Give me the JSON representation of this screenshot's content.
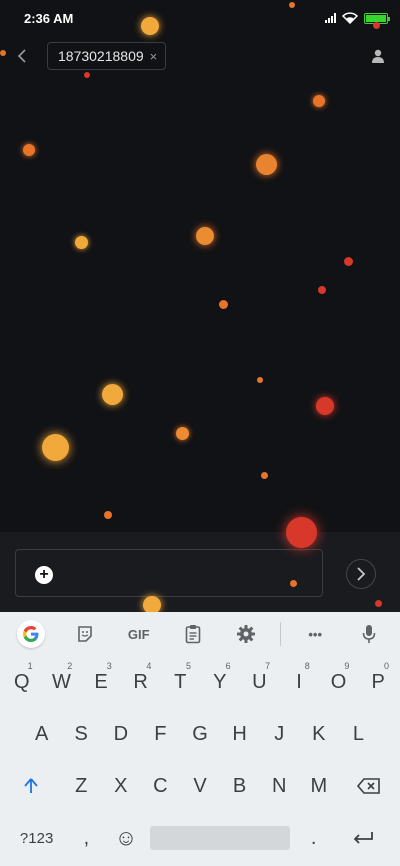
{
  "status": {
    "time": "2:36 AM"
  },
  "header": {
    "recipient": "18730218809",
    "remove_glyph": "×"
  },
  "icons": {
    "back": "chevron-left-icon",
    "person": "person-icon",
    "plus": "plus-icon",
    "send": "chevron-right-icon",
    "signal": "signal-icon",
    "wifi": "wifi-icon",
    "battery": "battery-icon"
  },
  "composer": {
    "plus_label": "+"
  },
  "keyboard": {
    "gif_label": "GIF",
    "more_label": "•••",
    "row1": [
      {
        "key": "Q",
        "sub": "1"
      },
      {
        "key": "W",
        "sub": "2"
      },
      {
        "key": "E",
        "sub": "3"
      },
      {
        "key": "R",
        "sub": "4"
      },
      {
        "key": "T",
        "sub": "5"
      },
      {
        "key": "Y",
        "sub": "6"
      },
      {
        "key": "U",
        "sub": "7"
      },
      {
        "key": "I",
        "sub": "8"
      },
      {
        "key": "O",
        "sub": "9"
      },
      {
        "key": "P",
        "sub": "0"
      }
    ],
    "row2": [
      "A",
      "S",
      "D",
      "F",
      "G",
      "H",
      "J",
      "K",
      "L"
    ],
    "row3": [
      "Z",
      "X",
      "C",
      "V",
      "B",
      "N",
      "M"
    ],
    "symbols_label": "?123",
    "comma_label": ",",
    "period_label": ".",
    "emoji_label": "☺"
  },
  "colors": {
    "background": "#111215",
    "composer_bg": "#1a1b1f",
    "keyboard_bg": "#eceff1",
    "accent_blue": "#1a73e8",
    "battery_green": "#38d430",
    "particle_gold": "#f2a93b",
    "particle_orange": "#e8742a",
    "particle_red": "#d8382a"
  }
}
